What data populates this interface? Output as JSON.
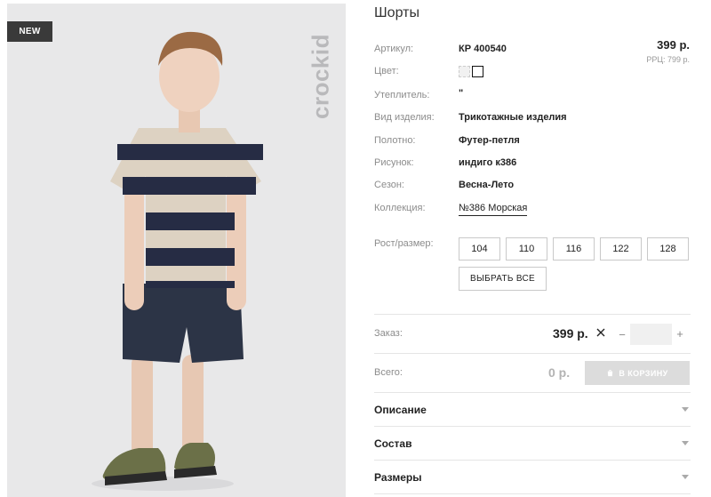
{
  "product": {
    "badge": "NEW",
    "brand_logo": "crockid",
    "title": "Шорты"
  },
  "attributes": [
    {
      "label": "Артикул:",
      "value": "КР 400540"
    },
    {
      "label": "Цвет:",
      "value": ""
    },
    {
      "label": "Утеплитель:",
      "value": "\""
    },
    {
      "label": "Вид изделия:",
      "value": "Трикотажные изделия"
    },
    {
      "label": "Полотно:",
      "value": "Футер-петля"
    },
    {
      "label": "Рисунок:",
      "value": "индиго к386"
    },
    {
      "label": "Сезон:",
      "value": "Весна-Лето"
    },
    {
      "label": "Коллекция:",
      "value": "№386 Морская"
    }
  ],
  "price": {
    "main": "399 р.",
    "rrp": "РРЦ: 799 р."
  },
  "sizes": {
    "label": "Рост/размер:",
    "options": [
      "104",
      "110",
      "116",
      "122",
      "128"
    ],
    "select_all": "ВЫБРАТЬ ВСЕ"
  },
  "order": {
    "label": "Заказ:",
    "price": "399 р.",
    "quantity": "",
    "minus": "−",
    "plus": "+"
  },
  "total": {
    "label": "Всего:",
    "value": "0 р.",
    "cart_button": "В КОРЗИНУ"
  },
  "accordion": [
    "Описание",
    "Состав",
    "Размеры"
  ],
  "colors": {
    "accent_dark": "#3a3a3a",
    "muted": "#8c8c8c",
    "disabled_button": "#dcdcdc"
  }
}
